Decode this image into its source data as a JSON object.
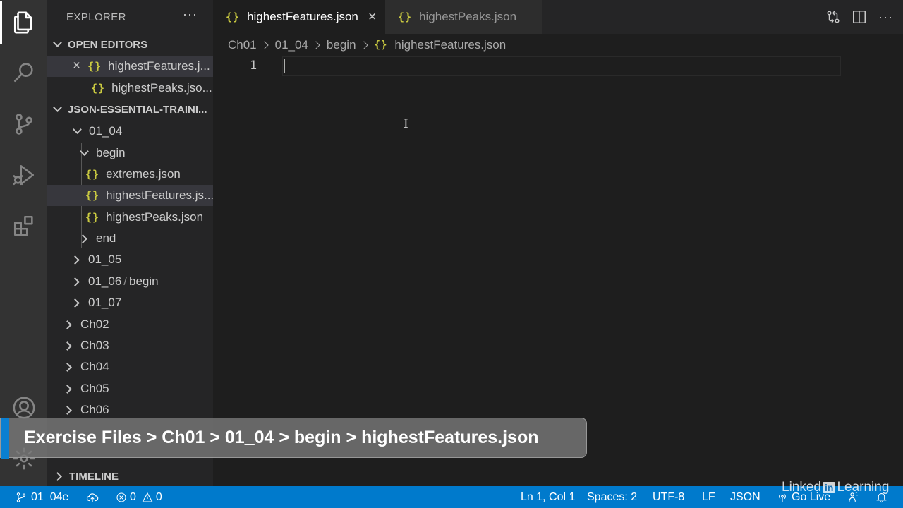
{
  "activity_bar": {
    "items": [
      "files-icon",
      "search-icon",
      "source-control-icon",
      "run-debug-icon",
      "extensions-icon"
    ],
    "bottom": [
      "account-icon",
      "settings-gear-icon"
    ]
  },
  "sidebar": {
    "title": "EXPLORER",
    "more": "···",
    "open_editors": {
      "header": "OPEN EDITORS",
      "items": [
        "highestFeatures.j...",
        "highestPeaks.jso..."
      ]
    },
    "project": {
      "header": "JSON-ESSENTIAL-TRAINI...",
      "tree": {
        "folder_0104": "01_04",
        "folder_begin": "begin",
        "file_extremes": "extremes.json",
        "file_highest_features": "highestFeatures.js...",
        "file_highest_peaks": "highestPeaks.json",
        "folder_end": "end",
        "folder_0105": "01_05",
        "folder_0106": "01_06",
        "folder_0106_sub": "begin",
        "folder_0107": "01_07",
        "ch02": "Ch02",
        "ch03": "Ch03",
        "ch04": "Ch04",
        "ch05": "Ch05",
        "ch06": "Ch06"
      }
    },
    "timeline": "TIMELINE",
    "json_glyph": "{}"
  },
  "tabs": {
    "active": "highestFeatures.json",
    "inactive": "highestPeaks.json",
    "close": "×",
    "more": "···"
  },
  "breadcrumb": {
    "parts": [
      "Ch01",
      "01_04",
      "begin",
      "highestFeatures.json"
    ]
  },
  "editor": {
    "line_number": "1",
    "ibeam": "I"
  },
  "statusbar": {
    "branch": "01_04e",
    "errors": "0",
    "warnings": "0",
    "position": "Ln 1, Col 1",
    "spaces": "Spaces: 2",
    "encoding": "UTF-8",
    "eol": "LF",
    "language": "JSON",
    "golive": "Go Live"
  },
  "banner": {
    "text": "Exercise Files > Ch01 > 01_04 > begin > highestFeatures.json"
  },
  "watermark": {
    "left": "Linked",
    "box": "in",
    "right": "Learning"
  },
  "colors": {
    "statusbar": "#007acc",
    "json_icon": "#cbcb41",
    "banner_accent": "#0a7fd1"
  }
}
